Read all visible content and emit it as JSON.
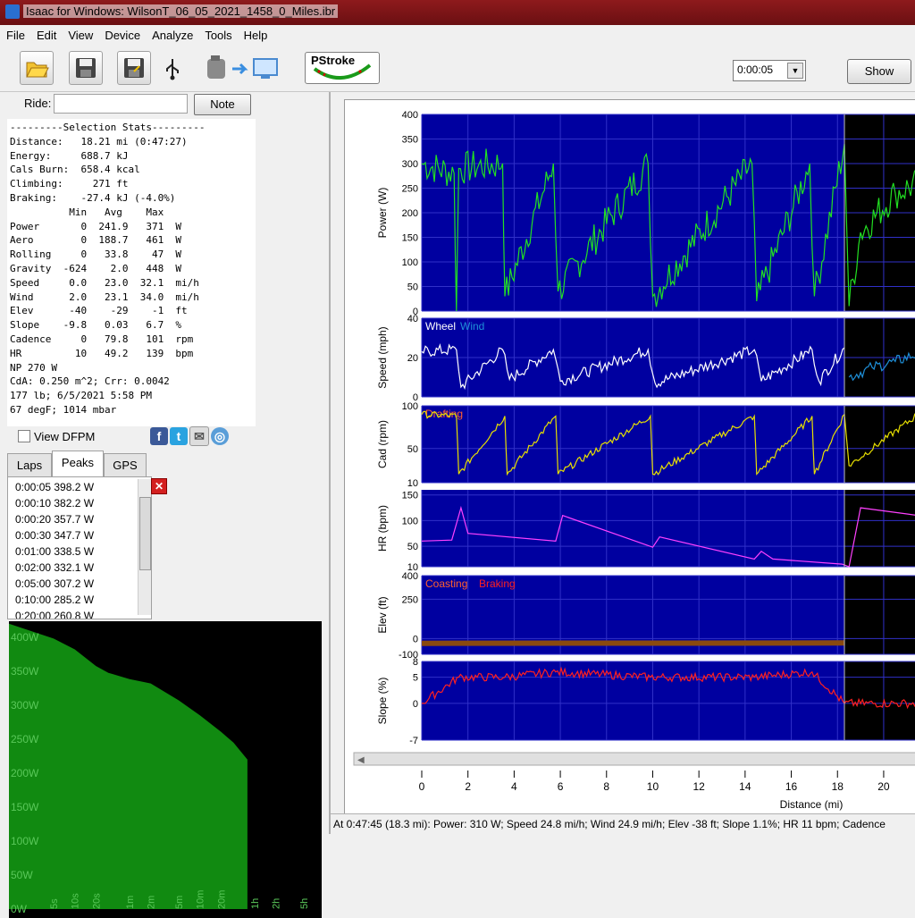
{
  "window": {
    "title": "Isaac for Windows:  WilsonT_06_05_2021_1458_0_Miles.ibr"
  },
  "menu": [
    "File",
    "Edit",
    "View",
    "Device",
    "Analyze",
    "Tools",
    "Help"
  ],
  "toolbar": {
    "icons": [
      "open-folder-icon",
      "save-icon",
      "save-as-icon",
      "usb-icon",
      "download-to-computer-icon"
    ],
    "pstroke_label": "PStroke",
    "interval_value": "0:00:05",
    "show_label": "Show"
  },
  "ride": {
    "label": "Ride:",
    "value": "",
    "note_label": "Note"
  },
  "stats_text": "---------Selection Stats---------\nDistance:   18.21 mi (0:47:27)\nEnergy:     688.7 kJ\nCals Burn:  658.4 kcal\nClimbing:     271 ft\nBraking:    -27.4 kJ (-4.0%)\n          Min   Avg    Max\nPower       0  241.9   371  W\nAero        0  188.7   461  W\nRolling     0   33.8    47  W\nGravity  -624    2.0   448  W\nSpeed     0.0   23.0  32.1  mi/h\nWind      2.0   23.1  34.0  mi/h\nElev      -40    -29    -1  ft\nSlope    -9.8   0.03   6.7  %\nCadence     0   79.8   101  rpm\nHR         10   49.2   139  bpm\nNP 270 W\nCdA: 0.250 m^2; Crr: 0.0042\n177 lb; 6/5/2021 5:58 PM\n67 degF; 1014 mbar",
  "view_dfpm_label": "View DFPM",
  "social": [
    "facebook-icon",
    "twitter-icon",
    "mail-icon",
    "web-icon"
  ],
  "tabs": [
    "Laps",
    "Peaks",
    "GPS"
  ],
  "active_tab": "Peaks",
  "peaks": [
    "0:00:05 398.2 W",
    "0:00:10 382.2 W",
    "0:00:20 357.7 W",
    "0:00:30 347.7 W",
    "0:01:00 338.5 W",
    "0:02:00 332.1 W",
    "0:05:00 307.2 W",
    "0:10:00 285.2 W",
    "0:20:00 260.8 W"
  ],
  "pdc": {
    "y_labels": [
      "400W",
      "350W",
      "300W",
      "250W",
      "200W",
      "150W",
      "100W",
      "50W",
      "0W"
    ],
    "x_labels": [
      "5s",
      "10s",
      "20s",
      "1m",
      "2m",
      "5m",
      "10m",
      "20m",
      "1h",
      "2h",
      "5h"
    ],
    "fill_color": "#118a11"
  },
  "chart_data": [
    {
      "type": "line",
      "ylabel": "Power (W)",
      "ylim": [
        0,
        400
      ],
      "yticks": [
        "0",
        "50",
        "100",
        "150",
        "200",
        "250",
        "300",
        "350",
        "400"
      ],
      "color": "#22e022",
      "series": [
        {
          "x": [
            0,
            1.4,
            1.5,
            1.6,
            3.5,
            3.6,
            5.7,
            5.9,
            9.8,
            10.0,
            14.3,
            14.5,
            16.8,
            17.0,
            18.3,
            18.5,
            19,
            20.5,
            21.5
          ],
          "values": [
            300,
            280,
            0,
            290,
            300,
            30,
            300,
            40,
            300,
            30,
            300,
            20,
            300,
            30,
            340,
            10,
            160,
            240,
            260
          ]
        }
      ]
    },
    {
      "type": "line",
      "ylabel": "Speed (mph)",
      "ylim": [
        0,
        40
      ],
      "yticks": [
        "0",
        "20",
        "40"
      ],
      "legend": [
        "Wheel",
        "Wind"
      ],
      "series": [
        {
          "name": "Wheel",
          "x": [
            0,
            1.5,
            1.7,
            3.5,
            3.8,
            5.7,
            6.0,
            9.8,
            10.1,
            14.4,
            14.7,
            16.9,
            17.2,
            18.3
          ],
          "values": [
            23,
            24,
            5,
            24,
            9,
            24,
            8,
            24,
            7,
            24,
            8,
            24,
            8,
            25
          ]
        },
        {
          "name": "Wind",
          "x": [
            18.5,
            19.5,
            20.5,
            21.5
          ],
          "values": [
            10,
            15,
            18,
            22
          ]
        }
      ]
    },
    {
      "type": "line",
      "ylabel": "Cad (rpm)",
      "ylim": [
        10,
        100
      ],
      "yticks": [
        "10",
        "50",
        "100"
      ],
      "legend": [
        "Drafting"
      ],
      "color": "#e8e000",
      "series": [
        {
          "x": [
            0,
            1.5,
            1.6,
            3.6,
            3.7,
            5.8,
            5.9,
            9.9,
            10.0,
            14.4,
            14.5,
            16.9,
            17.0,
            18.3,
            18.5,
            21.5
          ],
          "values": [
            90,
            88,
            20,
            88,
            20,
            88,
            20,
            88,
            20,
            88,
            20,
            88,
            20,
            90,
            30,
            90
          ]
        }
      ]
    },
    {
      "type": "line",
      "ylabel": "HR (bpm)",
      "ylim": [
        10,
        160
      ],
      "yticks": [
        "10",
        "50",
        "100",
        "150"
      ],
      "color": "#ff40ff",
      "series": [
        {
          "x": [
            0,
            1.3,
            1.7,
            2.0,
            5.8,
            6.1,
            10.0,
            10.3,
            14.4,
            14.7,
            15.2,
            18.2,
            18.5,
            19.0,
            21.5
          ],
          "values": [
            60,
            62,
            125,
            75,
            60,
            110,
            48,
            68,
            25,
            40,
            25,
            15,
            10,
            125,
            110
          ]
        }
      ]
    },
    {
      "type": "line",
      "ylabel": "Elev (ft)",
      "ylim": [
        -100,
        400
      ],
      "yticks": [
        "-100",
        "0",
        "250",
        "400"
      ],
      "legend": [
        "Coasting",
        "Braking"
      ],
      "series": [
        {
          "x": [
            0,
            18.3
          ],
          "values": [
            -30,
            -28
          ]
        }
      ]
    },
    {
      "type": "line",
      "ylabel": "Slope (%)",
      "ylim": [
        -7,
        8
      ],
      "yticks": [
        "-7",
        "0",
        "5",
        "8"
      ],
      "color": "#ff2020",
      "series": [
        {
          "x": [
            0,
            1.6,
            3.6,
            5.8,
            9.9,
            14.4,
            16.9,
            18.3,
            21.5
          ],
          "values": [
            0,
            5,
            5,
            6,
            5,
            5,
            6,
            0,
            0
          ]
        }
      ]
    }
  ],
  "xaxis": {
    "label": "Distance (mi)",
    "ticks": [
      "0",
      "2",
      "4",
      "6",
      "8",
      "10",
      "12",
      "14",
      "16",
      "18",
      "20"
    ]
  },
  "colors": {
    "plot_bg": "#0000a0",
    "selection_end_bg": "#000000",
    "coasting": "#ff6030",
    "braking": "#ff2020",
    "wheel": "#ffffff",
    "wind": "#1e8fd8"
  },
  "status": "At 0:47:45 (18.3 mi): Power: 310 W; Speed 24.8 mi/h; Wind 24.9 mi/h; Elev -38 ft; Slope 1.1%; HR 11 bpm; Cadence"
}
